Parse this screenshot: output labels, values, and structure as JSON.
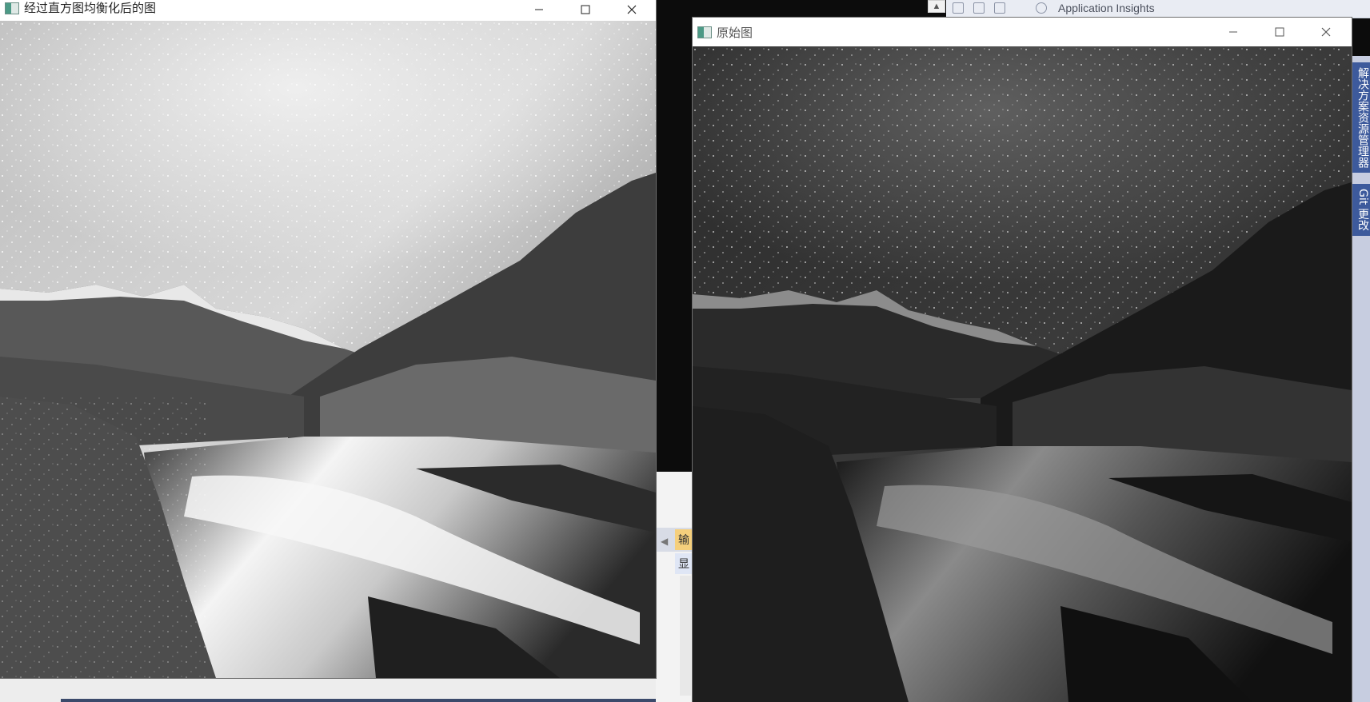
{
  "windows": {
    "equalized": {
      "title": "经过直方图均衡化后的图",
      "image_desc": "grayscale-night-landscape-equalized"
    },
    "original": {
      "title": "原始图",
      "image_desc": "grayscale-night-landscape-original"
    }
  },
  "ide": {
    "top_tab": "Application Insights",
    "output_tab_short": "输",
    "display_short": "显",
    "side_tabs": [
      "解决方案资源管理器",
      "Git 更改"
    ]
  },
  "icons": {
    "minimize": "minimize-icon",
    "maximize": "maximize-icon",
    "close": "close-icon",
    "app": "opencv-window-icon"
  }
}
